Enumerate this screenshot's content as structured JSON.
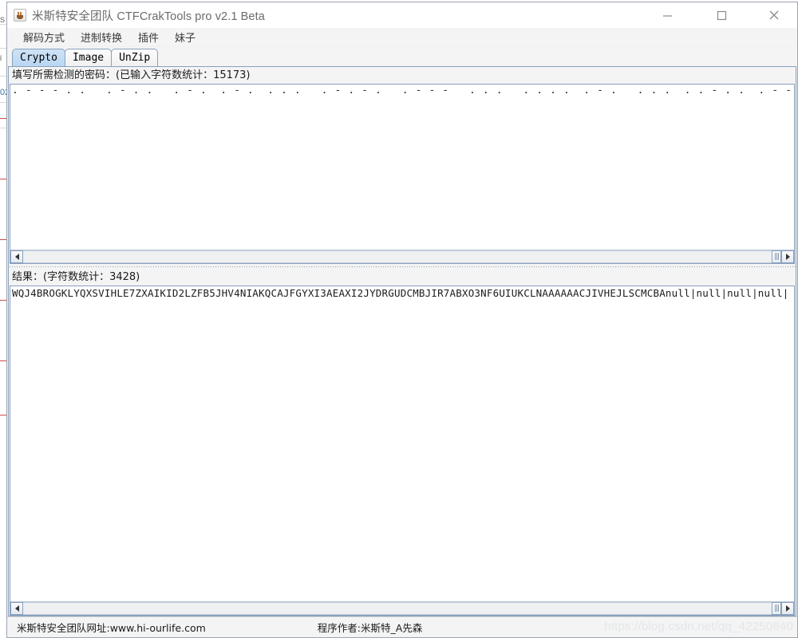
{
  "window": {
    "title": "米斯特安全团队 CTFCrakTools pro v2.1 Beta",
    "icon": "java-coffee-cup-icon",
    "controls": {
      "minimize": "—",
      "maximize": "□",
      "close": "✕"
    }
  },
  "menubar": {
    "items": [
      {
        "label": "解码方式"
      },
      {
        "label": "进制转换"
      },
      {
        "label": "插件"
      },
      {
        "label": "妹子"
      }
    ]
  },
  "tabs": [
    {
      "label": "Crypto",
      "selected": true
    },
    {
      "label": "Image",
      "selected": false
    },
    {
      "label": "UnZip",
      "selected": false
    }
  ],
  "input_section": {
    "label": "填写所需检测的密码：(已输入字符数统计：15173)",
    "char_count": "15173",
    "value": ". - - - . .   . - . .   . - .  . - .  . . .   . - . - .   . - - -   . . .   . . . .  . - .   . . .  . . - . .  . - - . - .   . - .   . . .  . - -   . .  . - .   . - . -  . . . .  . - .   . .  . . . .   - - -   . . . .  . - - .   . .  . . . .   . - - .  . - . -   . - . .  . . . .  . - .   . . - . - . .  . .  . . . . .   . - .   . . . . - .  . . .  . - . .   . - .  . . . . .   . . - . .  . - - .  . . .   . - . - . .   . . . . . . -  . . .  . - -   . - . .  . . - .  . - . .   . . - - .   . . . .  . - .  . . . . .",
    "scrollbar": {
      "left_arrow": "◀",
      "right_arrow": "▶",
      "grip": "⦀"
    }
  },
  "result_section": {
    "label": "结果：(字符数统计：3428)",
    "char_count": "3428",
    "value": "WQJ4BROGKLYQXSVIHLE7ZXAIKID2LZFB5JHV4NIAKQCAJFGYXI3AEAXI2JYDRGUDCMBJIR7ABXO3NF6UIUKCLNAAAAAACJIVHEJLSCMCBAnull|null|null|null|",
    "scrollbar": {
      "left_arrow": "◀",
      "right_arrow": "▶",
      "grip": "⦀"
    }
  },
  "statusbar": {
    "site": "米斯特安全团队网址:www.hi-ourlife.com",
    "author": "程序作者:米斯特_A先森"
  },
  "watermark": "https://blog.csdn.net/qq_42250840",
  "colors": {
    "tab_selected": "#b8d6f2",
    "border": "#8aa0bd",
    "panel": "#f4f4f4",
    "text": "#1a1a1a",
    "title_text": "#6b6b6b",
    "watermark": "#e3e6ea"
  },
  "background_window": {
    "fragments": [
      "S",
      "ǐ",
      "02"
    ]
  }
}
